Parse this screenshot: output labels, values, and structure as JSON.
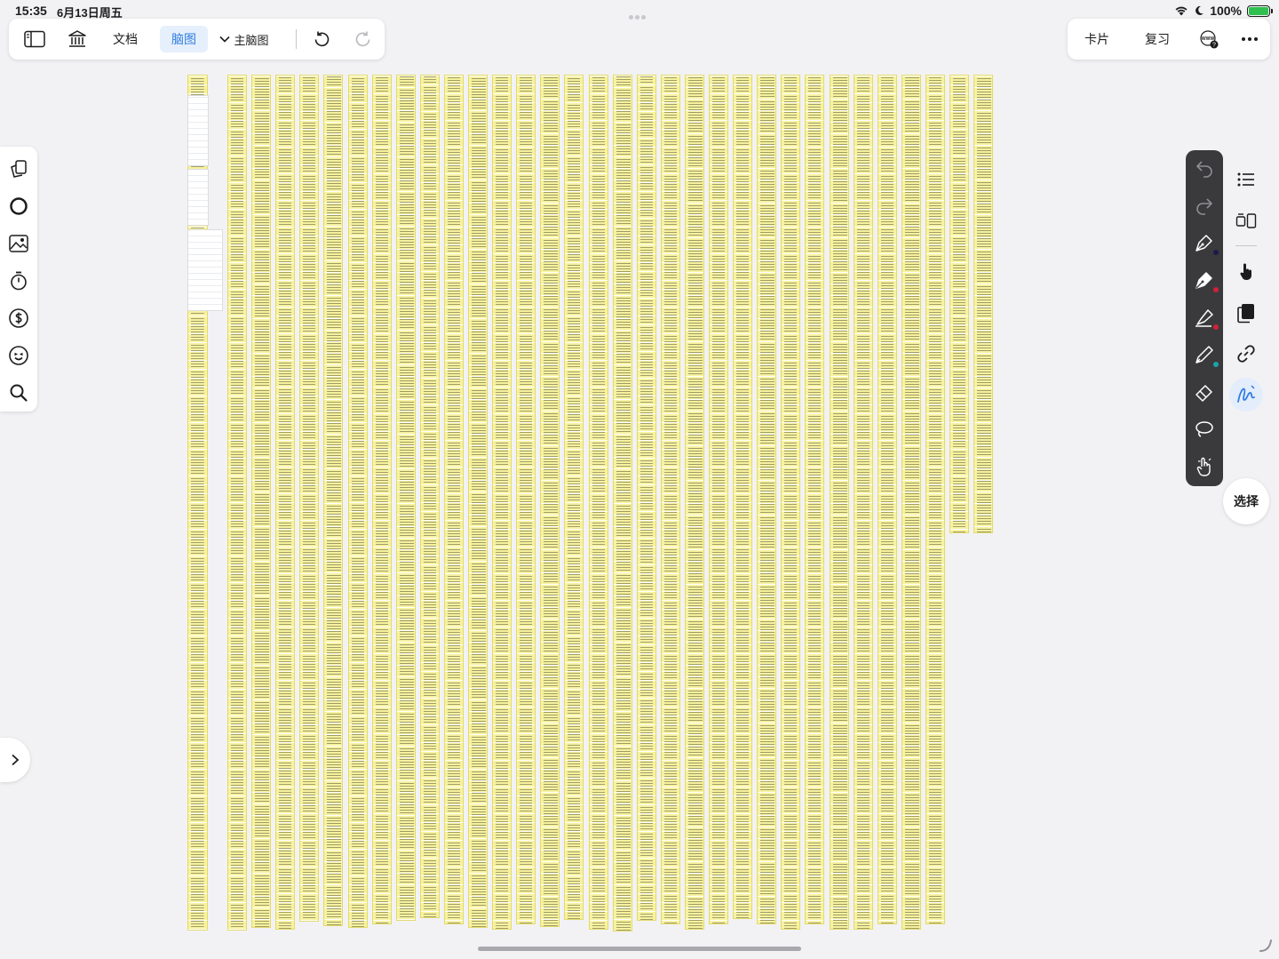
{
  "status_bar": {
    "time": "15:35",
    "date": "6月13日周五",
    "battery": "100%"
  },
  "toolbar": {
    "tab_document": "文档",
    "tab_mindmap": "脑图",
    "mindmap_name": "主脑图"
  },
  "toolbar_right": {
    "cards": "卡片",
    "review": "复习",
    "web_badge": "WWW"
  },
  "right_panel": {
    "select_label": "选择"
  },
  "colors": {
    "card_yellow": "#f7f2a0",
    "accent_blue": "#2f7de1",
    "pen_bar": "#3a3a3c",
    "pen_dark": "#1a1a4a",
    "pen_red": "#d0213a",
    "highlighter_red": "#d0213a",
    "pencil_teal": "#1aa4a8"
  },
  "icons": {
    "left_panel": [
      "copy-cards-icon",
      "circle-icon",
      "image-icon",
      "timer-icon",
      "dollar-icon",
      "sticker-icon",
      "search-icon"
    ],
    "pen_tools": [
      "undo-icon",
      "redo-icon",
      "fountain-pen-icon",
      "pen-icon",
      "highlighter-icon",
      "pencil-icon",
      "eraser-icon",
      "lasso-icon",
      "hand-gesture-icon"
    ],
    "right_panel": [
      "outline-list-icon",
      "layout-icon",
      "pointer-hand-icon",
      "pages-icon",
      "link-icon",
      "handwriting-icon"
    ]
  }
}
